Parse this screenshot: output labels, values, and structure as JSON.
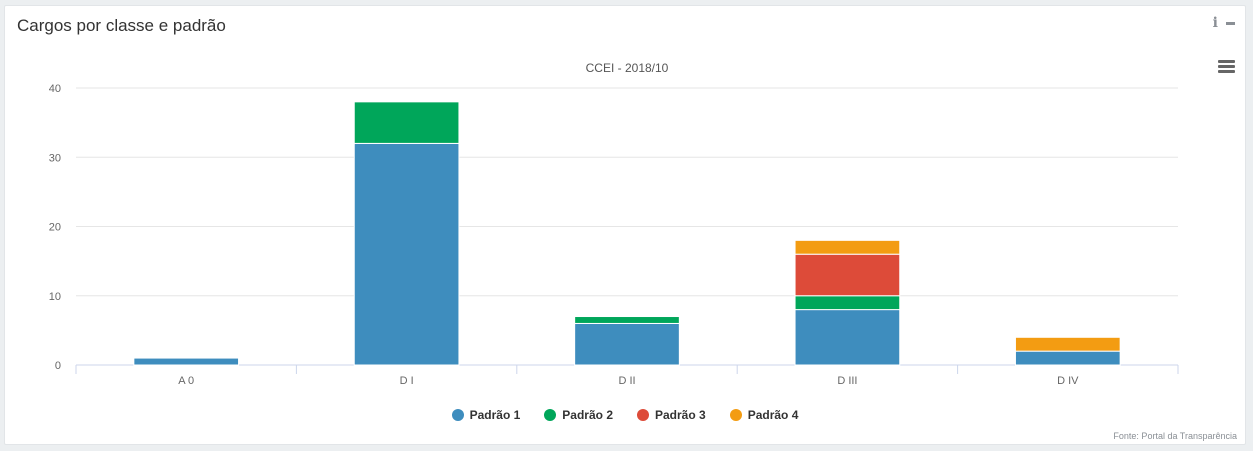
{
  "panel": {
    "title": "Cargos por classe e padrão",
    "source": "Fonte: Portal da Transparência",
    "info_icon": "info-icon",
    "minimize_icon": "minimize-icon",
    "menu_icon": "hamburger-menu-icon"
  },
  "chart_data": {
    "type": "bar",
    "stacked": true,
    "title": "CCEI - 2018/10",
    "xlabel": "",
    "ylabel": "",
    "categories": [
      "A 0",
      "D I",
      "D II",
      "D III",
      "D IV"
    ],
    "ylim": [
      0,
      40
    ],
    "yticks": [
      0,
      10,
      20,
      30,
      40
    ],
    "grid": true,
    "legend_position": "bottom-center",
    "series": [
      {
        "name": "Padrão 1",
        "color": "#3e8dbe",
        "values": [
          1,
          32,
          6,
          8,
          2
        ]
      },
      {
        "name": "Padrão 2",
        "color": "#00a65a",
        "values": [
          0,
          6,
          1,
          2,
          0
        ]
      },
      {
        "name": "Padrão 3",
        "color": "#dd4b39",
        "values": [
          0,
          0,
          0,
          6,
          0
        ]
      },
      {
        "name": "Padrão 4",
        "color": "#f39c12",
        "values": [
          0,
          0,
          0,
          2,
          2
        ]
      }
    ]
  }
}
